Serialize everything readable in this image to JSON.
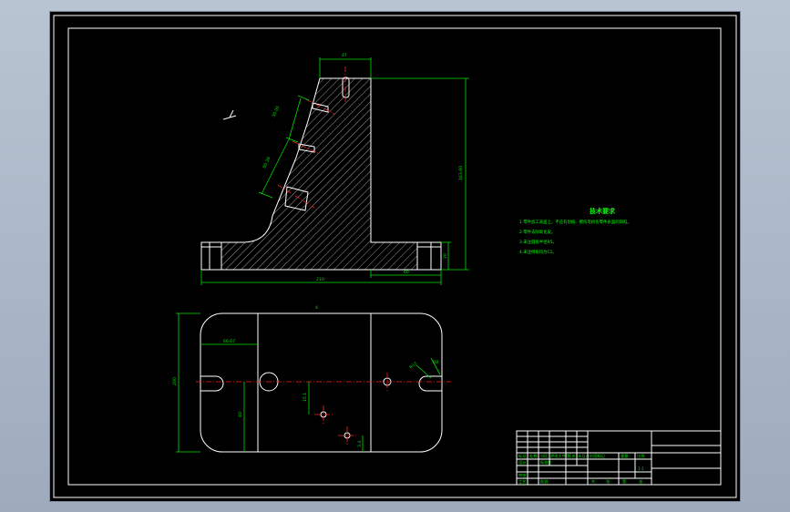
{
  "dimensions": {
    "top_width": "47",
    "slot_pitch_1": "30.05",
    "slot_pitch_2": "80.39",
    "height": "163.60",
    "base_height": "20",
    "flange_width": "60",
    "overall_length": "210",
    "plan_offset": "66.07",
    "plan_height": "200",
    "hole_y": "15.1",
    "plan_section": "4",
    "hole_x": "40",
    "small_dim": "3.4",
    "radius_1": "R12",
    "radius_2": "R8"
  },
  "tech_notes": {
    "title": "技术要求",
    "lines": [
      "1.零件加工表面上，不应有划痕、擦伤等损伤零件表面的缺陷。",
      "2.零件去除氧化皮。",
      "3.未注圆角半径R5。",
      "4.未注倒角均为C1。"
    ]
  },
  "title_block": {
    "cells": [
      "标记",
      "处数",
      "分区",
      "更改文件号",
      "签名",
      "年月日",
      "设计",
      "标准化",
      "阶段标记",
      "重量",
      "比例",
      "审核",
      "工艺",
      "批准",
      "共",
      "张",
      "第",
      "张",
      "1:1"
    ]
  }
}
